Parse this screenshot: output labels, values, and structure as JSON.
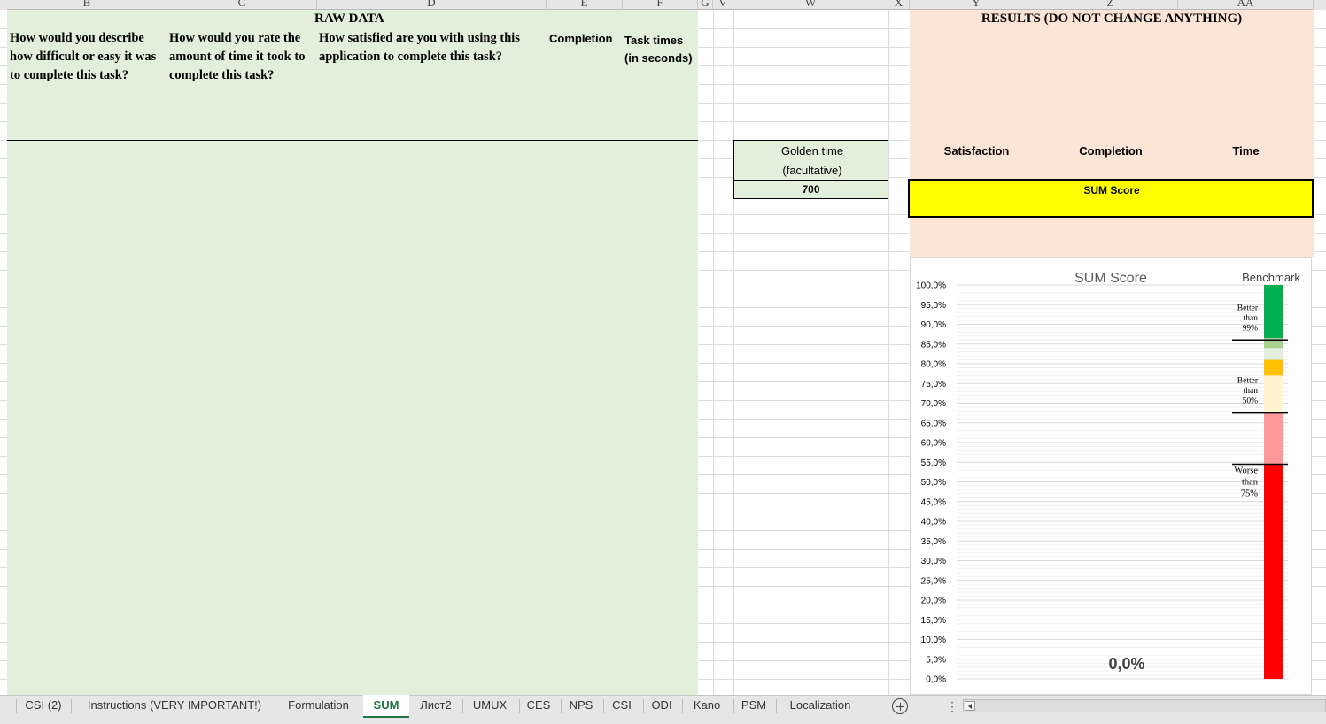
{
  "columns": [
    {
      "id": "col-b",
      "label": "B"
    },
    {
      "id": "col-c",
      "label": "C"
    },
    {
      "id": "col-d",
      "label": "D"
    },
    {
      "id": "col-e",
      "label": "E"
    },
    {
      "id": "col-f",
      "label": "F"
    },
    {
      "id": "col-g",
      "label": "G"
    },
    {
      "id": "col-v",
      "label": "V"
    },
    {
      "id": "col-w",
      "label": "W"
    },
    {
      "id": "col-x",
      "label": "X"
    },
    {
      "id": "col-y",
      "label": "Y"
    },
    {
      "id": "col-z",
      "label": "Z"
    },
    {
      "id": "col-aa",
      "label": "AA"
    }
  ],
  "raw": {
    "title": "RAW DATA",
    "q1": "How would you describe how difficult or easy it was to complete this task?",
    "q2": "How would you rate the amount of time it took to complete this task?",
    "q3": "How satisfied are you with using this application to complete this task?",
    "completion": "Completion",
    "task_times": "Task times (in seconds)"
  },
  "golden": {
    "label": "Golden time (facultative)",
    "value": "700"
  },
  "results": {
    "title": "RESULTS (DO NOT CHANGE ANYTHING)",
    "satisfaction": "Satisfaction",
    "completion": "Completion",
    "time": "Time",
    "sum_score": "SUM Score"
  },
  "chart_data": {
    "type": "bar",
    "title": "SUM Score",
    "secondary_title": "Benchmark",
    "value_label": "0,0%",
    "value": 0,
    "ylim": [
      0,
      100
    ],
    "yticks": [
      "0,0%",
      "5,0%",
      "10,0%",
      "15,0%",
      "20,0%",
      "25,0%",
      "30,0%",
      "35,0%",
      "40,0%",
      "45,0%",
      "50,0%",
      "55,0%",
      "60,0%",
      "65,0%",
      "70,0%",
      "75,0%",
      "80,0%",
      "85,0%",
      "90,0%",
      "95,0%",
      "100,0%"
    ],
    "benchmark_bands": [
      {
        "from": 0,
        "to": 54.5,
        "color": "#ff0000"
      },
      {
        "from": 54.5,
        "to": 67.5,
        "color": "#ff9999"
      },
      {
        "from": 67.5,
        "to": 77,
        "color": "#fff2cc"
      },
      {
        "from": 77,
        "to": 81,
        "color": "#ffc000"
      },
      {
        "from": 81,
        "to": 84,
        "color": "#e2efda"
      },
      {
        "from": 84,
        "to": 86.5,
        "color": "#a9d18e"
      },
      {
        "from": 86.5,
        "to": 100,
        "color": "#00b050"
      }
    ],
    "benchmark_lines": [
      {
        "value": 86,
        "label": "Better than 99%"
      },
      {
        "value": 67.5,
        "label": "Better than 50%"
      },
      {
        "value": 54.5,
        "label": "Worse than 75%"
      }
    ],
    "grid": true,
    "legend": "none"
  },
  "tabs": [
    {
      "label": "CSI (2)"
    },
    {
      "label": "Instructions (VERY IMPORTANT!)"
    },
    {
      "label": "Formulation"
    },
    {
      "label": "SUM",
      "active": true
    },
    {
      "label": "Лист2"
    },
    {
      "label": "UMUX"
    },
    {
      "label": "CES"
    },
    {
      "label": "NPS"
    },
    {
      "label": "CSI"
    },
    {
      "label": "ODI"
    },
    {
      "label": "Kano"
    },
    {
      "label": "PSM"
    },
    {
      "label": "Localization"
    }
  ],
  "add_sheet_icon": "plus-circle-icon",
  "more_icon": "vertical-ellipsis-icon",
  "scroll_left_icon": "chevron-left-icon",
  "colors": {
    "raw_bg": "#e2efda",
    "results_bg": "#fce4d6",
    "sum_highlight": "#ffff00",
    "active_tab_text": "#217346"
  }
}
